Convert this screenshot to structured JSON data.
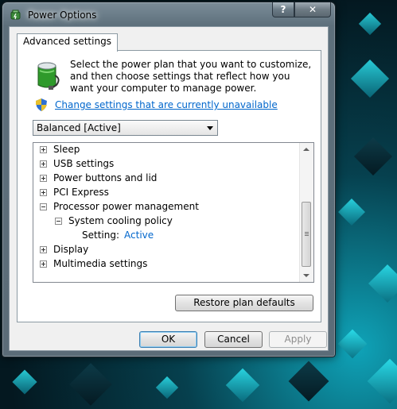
{
  "window": {
    "title": "Power Options"
  },
  "caption": {
    "help": "?",
    "close": "✕"
  },
  "tab": {
    "label": "Advanced settings"
  },
  "description": "Select the power plan that you want to customize, and then choose settings that reflect how you want your computer to manage power.",
  "change_link": "Change settings that are currently unavailable",
  "plan_select": {
    "value": "Balanced [Active]"
  },
  "tree": {
    "items": [
      {
        "label": "Sleep",
        "expanded": false
      },
      {
        "label": "USB settings",
        "expanded": false
      },
      {
        "label": "Power buttons and lid",
        "expanded": false
      },
      {
        "label": "PCI Express",
        "expanded": false
      },
      {
        "label": "Processor power management",
        "expanded": true
      },
      {
        "label": "System cooling policy",
        "expanded": true
      },
      {
        "label": "Setting:",
        "value": "Active"
      },
      {
        "label": "Display",
        "expanded": false
      },
      {
        "label": "Multimedia settings",
        "expanded": false
      }
    ]
  },
  "buttons": {
    "restore": "Restore plan defaults",
    "ok": "OK",
    "cancel": "Cancel",
    "apply": "Apply"
  },
  "colors": {
    "link": "#0066cc",
    "wallpaper_accent": "#2ee6f2"
  }
}
